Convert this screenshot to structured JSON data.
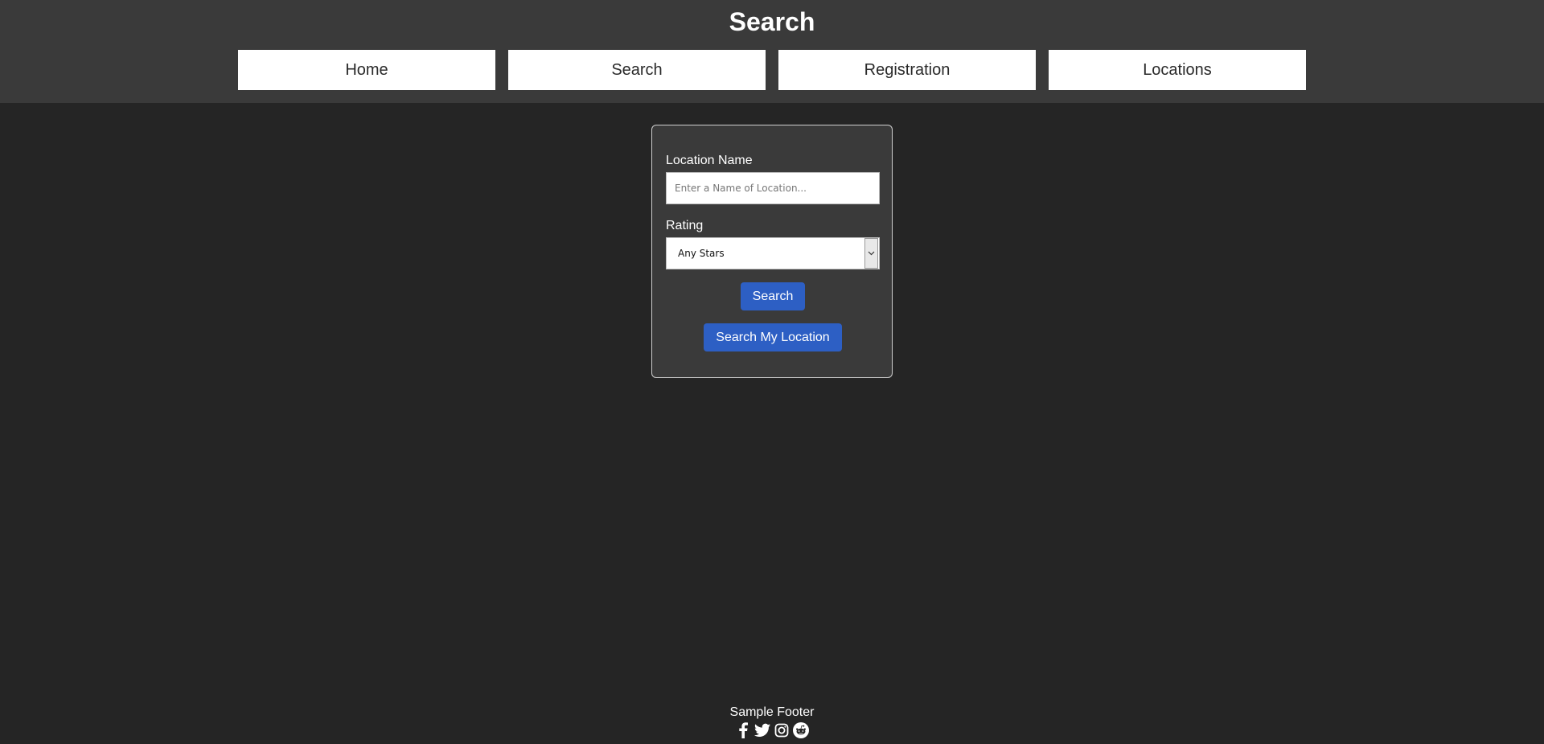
{
  "header": {
    "title": "Search",
    "nav": [
      {
        "label": "Home"
      },
      {
        "label": "Search"
      },
      {
        "label": "Registration"
      },
      {
        "label": "Locations"
      }
    ]
  },
  "search_form": {
    "location_label": "Location Name",
    "location_placeholder": "Enter a Name of Location...",
    "location_value": "",
    "rating_label": "Rating",
    "rating_selected": "Any Stars",
    "search_button": "Search",
    "search_my_location_button": "Search My Location"
  },
  "footer": {
    "text": "Sample Footer",
    "social_icons": [
      "facebook-icon",
      "twitter-icon",
      "instagram-icon",
      "reddit-icon"
    ]
  },
  "colors": {
    "page_bg": "#252525",
    "header_bg": "#3a3a3a",
    "card_bg": "#3a3a3a",
    "button_bg": "#2d5fc4",
    "nav_bg": "#ffffff"
  }
}
